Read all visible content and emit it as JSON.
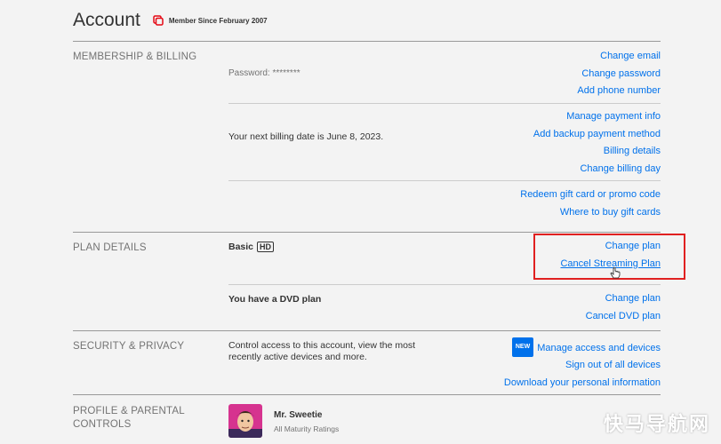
{
  "page": {
    "title": "Account",
    "member_since": "Member Since February 2007"
  },
  "membership": {
    "label": "MEMBERSHIP & BILLING",
    "password": "Password: ********",
    "billing_date": "Your next billing date is June 8, 2023.",
    "account_links": [
      "Change email",
      "Change password",
      "Add phone number"
    ],
    "billing_links": [
      "Manage payment info",
      "Add backup payment method",
      "Billing details",
      "Change billing day"
    ],
    "gift_links": [
      "Redeem gift card or promo code",
      "Where to buy gift cards"
    ]
  },
  "plan": {
    "label": "PLAN DETAILS",
    "streaming_plan": "Basic",
    "streaming_badge": "HD",
    "streaming_links": [
      "Change plan",
      "Cancel Streaming Plan"
    ],
    "dvd_text": "You have a DVD plan",
    "dvd_links": [
      "Change plan",
      "Cancel DVD plan"
    ]
  },
  "security": {
    "label": "SECURITY & PRIVACY",
    "description_line1": "Control access to this account, view the most",
    "description_line2": "recently active devices and more.",
    "new_badge": "NEW",
    "links": [
      "Manage access and devices",
      "Sign out of all devices",
      "Download your personal information"
    ]
  },
  "profile": {
    "label_line1": "PROFILE & PARENTAL",
    "label_line2": "CONTROLS",
    "name": "Mr. Sweetie",
    "rating": "All Maturity Ratings"
  },
  "watermark": "快马导航网",
  "colors": {
    "link": "#0071eb",
    "highlight": "#e02020",
    "badge": "#0071eb"
  }
}
